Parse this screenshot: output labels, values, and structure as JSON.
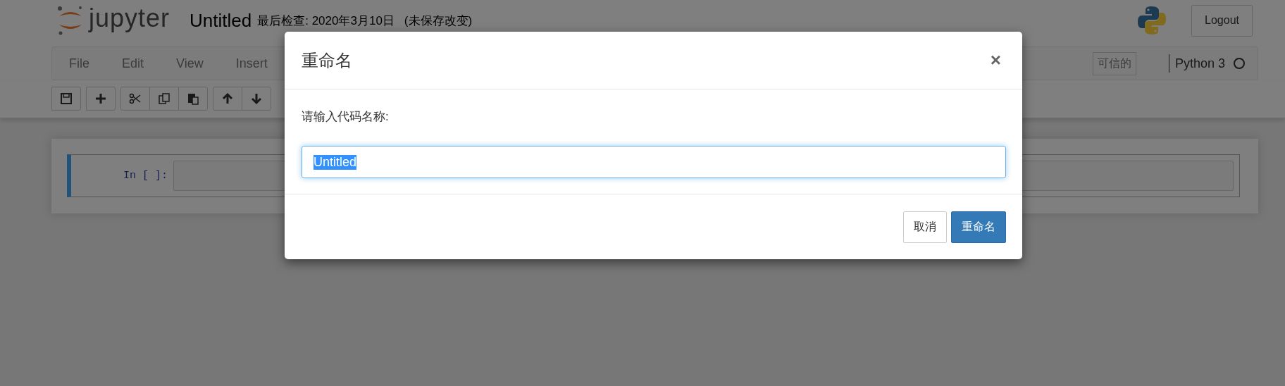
{
  "header": {
    "logo_text": "jupyter",
    "notebook_name": "Untitled",
    "checkpoint": "最后检查: 2020年3月10日",
    "autosave_status": "(未保存改变)",
    "logout": "Logout"
  },
  "menubar": {
    "items": [
      "File",
      "Edit",
      "View",
      "Insert"
    ],
    "trusted": "可信的",
    "kernel": {
      "name": "Python 3",
      "busy": false
    }
  },
  "cell": {
    "selected": true,
    "prompt": "In [ ]:"
  },
  "dialog": {
    "title": "重命名",
    "close": "×",
    "label": "请输入代码名称:",
    "input": {
      "value": "Untitled",
      "text_selected": true
    },
    "buttons": [
      {
        "label": "取消",
        "kind": "default"
      },
      {
        "label": "重命名",
        "kind": "primary"
      }
    ]
  }
}
